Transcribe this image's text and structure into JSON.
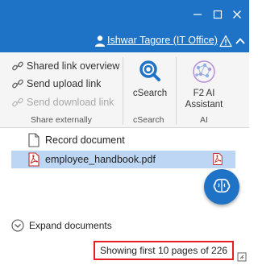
{
  "header": {
    "user_label": "Ishwar Tagore (IT Office)",
    "accent_color": "#1f73c7",
    "icons": [
      "minimize-icon",
      "maximize-icon",
      "close-icon",
      "user-icon",
      "warning-icon",
      "chevron-up-icon"
    ]
  },
  "ribbon": {
    "share_group": {
      "items": [
        {
          "label": "Shared link overview",
          "icon": "shared-link-icon",
          "enabled": true
        },
        {
          "label": "Send upload link",
          "icon": "upload-link-icon",
          "enabled": true
        },
        {
          "label": "Send download link",
          "icon": "download-link-icon",
          "enabled": false
        }
      ],
      "group_label": "Share externally"
    },
    "csearch_group": {
      "button_label": "cSearch",
      "group_label": "cSearch",
      "icon": "csearch-icon"
    },
    "ai_group": {
      "button_label_line1": "F2 AI",
      "button_label_line2": "Assistant",
      "group_label": "AI",
      "icon": "ai-brain-icon"
    }
  },
  "documents": [
    {
      "name": "Record document",
      "icon": "document-icon",
      "selected": false
    },
    {
      "name": "employee_handbook.pdf",
      "icon": "pdf-icon",
      "selected": true
    }
  ],
  "expand_label": "Expand documents",
  "status_text": "Showing first 10 pages of 226",
  "highlight_color": "#e41e1e"
}
